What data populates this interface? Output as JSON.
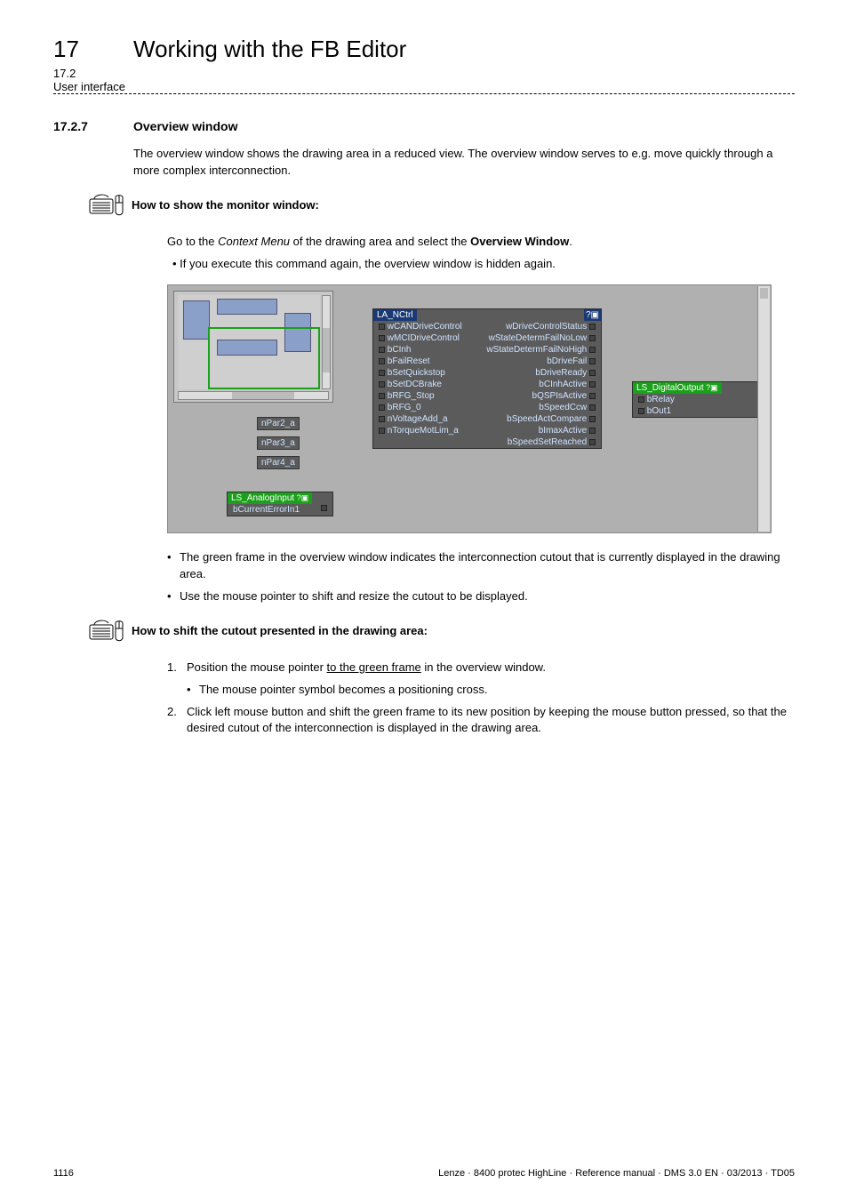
{
  "header": {
    "chapter_num": "17",
    "chapter_title": "Working with the FB Editor",
    "sub_num": "17.2",
    "sub_title": "User interface"
  },
  "section": {
    "num": "17.2.7",
    "title": "Overview window"
  },
  "p1": "The overview window shows the drawing area in a reduced view. The overview window serves to e.g. move quickly through a more complex interconnection.",
  "howto1": "How to show the monitor window:",
  "howto1_goto_pre": "Go to the ",
  "howto1_goto_em": "Context Menu",
  "howto1_goto_mid": " of the drawing area and select the ",
  "howto1_goto_b": "Overview Window",
  "howto1_goto_post": ".",
  "howto1_sub": "If you execute this command again, the overview window is hidden again.",
  "shot": {
    "block_title": "LA_NCtrl",
    "left_ports": [
      "wCANDriveControl",
      "wMCIDriveControl",
      "bCInh",
      "bFailReset",
      "bSetQuickstop",
      "bSetDCBrake",
      "bRFG_Stop",
      "bRFG_0",
      "nVoltageAdd_a",
      "nTorqueMotLim_a"
    ],
    "right_ports": [
      "wDriveControlStatus",
      "wStateDetermFailNoLow",
      "wStateDetermFailNoHigh",
      "bDriveFail",
      "bDriveReady",
      "bCInhActive",
      "bQSPIsActive",
      "bSpeedCcw",
      "bSpeedActCompare",
      "bImaxActive",
      "bSpeedSetReached"
    ],
    "npar": [
      "nPar2_a",
      "nPar3_a",
      "nPar4_a"
    ],
    "ls_analog": "LS_AnalogInput",
    "ls_analog_port": "bCurrentErrorIn1",
    "ls_digital": "LS_DigitalOutput",
    "ls_digital_ports": [
      "bRelay",
      "bOut1"
    ]
  },
  "b1": "The green frame in the overview window indicates the interconnection cutout that is currently displayed in the drawing area.",
  "b2": "Use the mouse pointer to shift and resize the cutout to be displayed.",
  "howto2": "How to shift the cutout presented in the drawing area:",
  "step1_pre": "Position the mouse pointer ",
  "step1_u": "to the green frame",
  "step1_post": " in the overview window.",
  "step1_sub": "The mouse pointer symbol becomes a positioning cross.",
  "step2": "Click left mouse button and shift the green frame to its new position by keeping the mouse button pressed, so that the desired cutout of the interconnection is displayed in the drawing area.",
  "footer": {
    "page": "1116",
    "right": "Lenze · 8400 protec HighLine · Reference manual · DMS 3.0 EN · 03/2013 · TD05"
  }
}
